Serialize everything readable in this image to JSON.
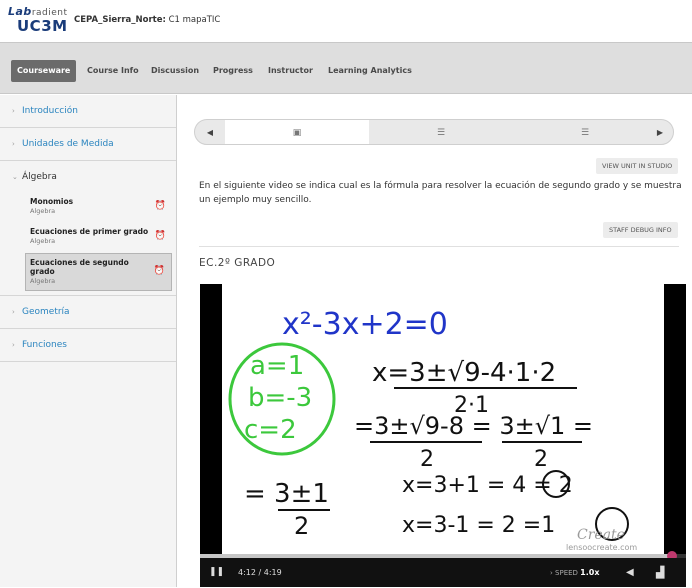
{
  "header": {
    "logo_line1_a": "Lab",
    "logo_line1_b": "radient",
    "logo_line2": "UC3M",
    "course_org": "CEPA_Sierra_Norte:",
    "course_name": "C1 mapaTIC"
  },
  "nav": {
    "tabs": [
      {
        "label": "Courseware",
        "active": true
      },
      {
        "label": "Course Info"
      },
      {
        "label": "Discussion"
      },
      {
        "label": "Progress"
      },
      {
        "label": "Instructor"
      },
      {
        "label": "Learning Analytics"
      }
    ]
  },
  "sidebar": {
    "sections": [
      {
        "label": "Introducción"
      },
      {
        "label": "Unidades de Medida"
      },
      {
        "label": "Álgebra",
        "items": [
          {
            "title": "Monomios",
            "subtitle": "Algebra"
          },
          {
            "title": "Ecuaciones de primer grado",
            "subtitle": "Algebra"
          },
          {
            "title": "Ecuaciones de segundo grado",
            "subtitle": "Algebra"
          }
        ]
      },
      {
        "label": "Geometría"
      },
      {
        "label": "Funciones"
      }
    ]
  },
  "main": {
    "view_unit_label": "VIEW UNIT IN STUDIO",
    "description": "En el siguiente video se indica cual es la fórmula para resolver la ecuación de segundo grado y se muestra un ejemplo muy sencillo.",
    "staff_debug_label": "STAFF DEBUG INFO",
    "unit_title": "EC.2º GRADO"
  },
  "video": {
    "equation_top": "x²-3x+2=0",
    "time": "4:12 / 4:19",
    "progress_fraction": 0.972,
    "speed_label": "SPEED",
    "speed_value": "1.0x",
    "watermark": "lensoocreate.com",
    "watermark_logo": "Create"
  },
  "colors": {
    "link_blue": "#2a84bf",
    "marker_blue": "#2035c8",
    "marker_green": "#3cc83c",
    "handle_pink": "#c0396e"
  }
}
